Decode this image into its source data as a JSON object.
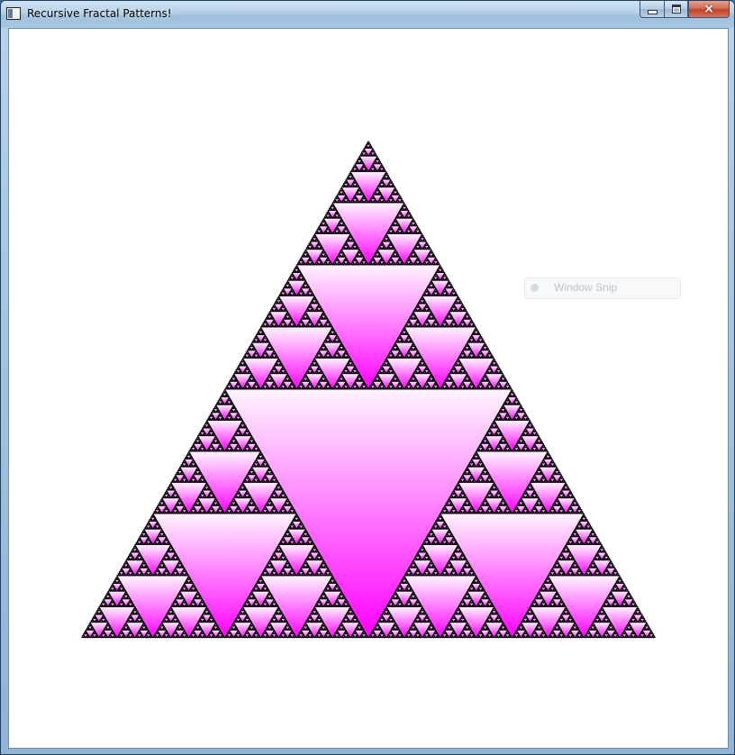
{
  "window": {
    "title": "Recursive Fractal Patterns!",
    "icon": "app-window-icon",
    "buttons": {
      "minimize": "minimize-icon",
      "maximize": "maximize-icon",
      "close": "×"
    }
  },
  "overlay": {
    "label": "Window Snip"
  },
  "fractal": {
    "type": "sierpinski-triangle",
    "fill_top": "#fff4fd",
    "fill_bottom": "#ff00ff",
    "outline": "#000000",
    "background": "#ffffff"
  }
}
